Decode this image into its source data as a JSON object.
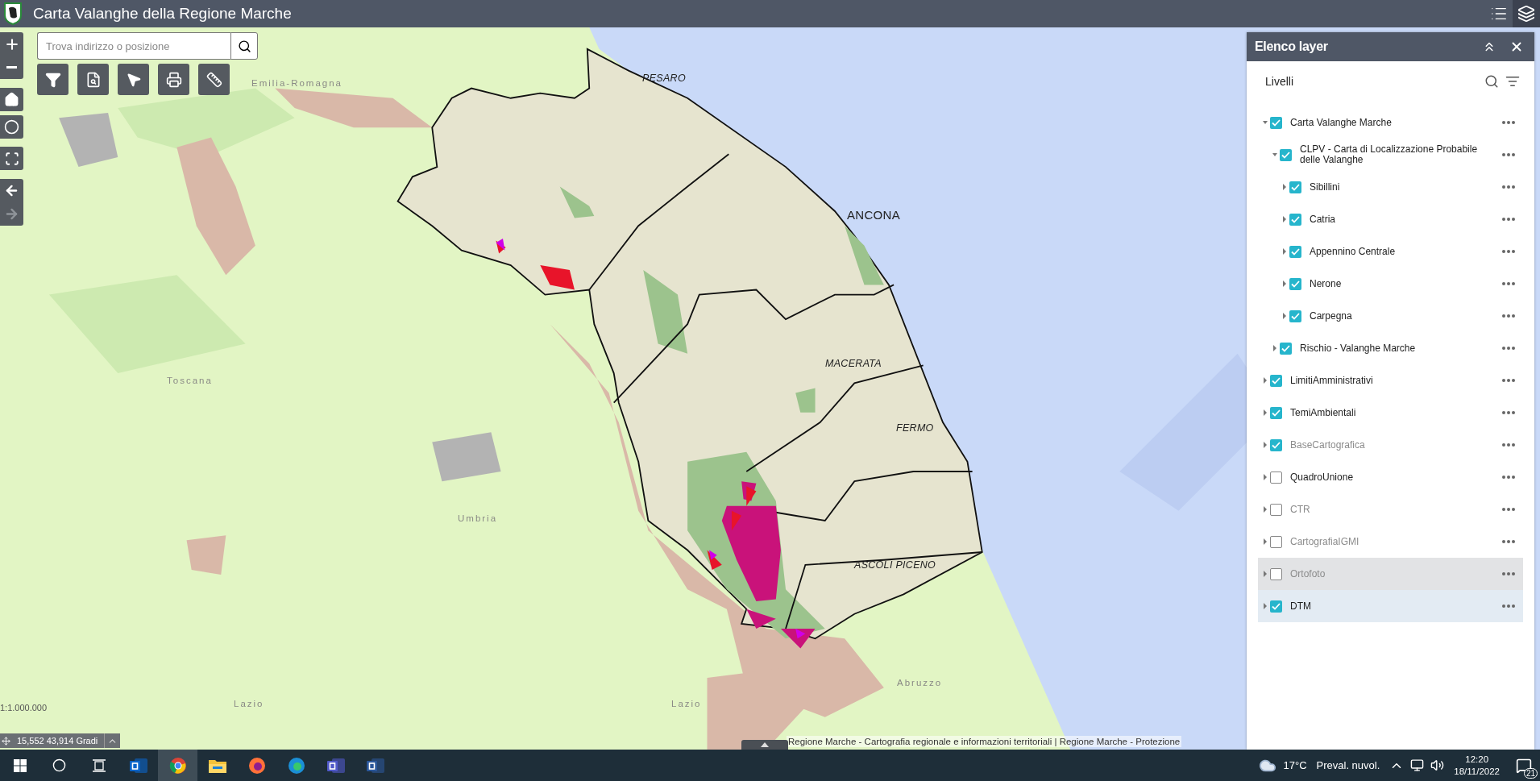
{
  "header": {
    "title": "Carta Valanghe della Regione Marche"
  },
  "search": {
    "placeholder": "Trova indirizzo o posizione"
  },
  "map": {
    "labels": [
      {
        "text": "Emilia-Romagna",
        "kind": "region"
      },
      {
        "text": "PESARO",
        "kind": "province"
      },
      {
        "text": "ANCONA",
        "kind": "capital"
      },
      {
        "text": "MACERATA",
        "kind": "province"
      },
      {
        "text": "FERMO",
        "kind": "province"
      },
      {
        "text": "ASCOLI PICENO",
        "kind": "province"
      },
      {
        "text": "Toscana",
        "kind": "region"
      },
      {
        "text": "Umbria",
        "kind": "region"
      },
      {
        "text": "Lazio",
        "kind": "region"
      },
      {
        "text": "Lazio",
        "kind": "region"
      },
      {
        "text": "Abruzzo",
        "kind": "region"
      }
    ],
    "scale": "1:1.000.000",
    "coordinates": "15,552 43,914 Gradi",
    "attribution": "Regione Marche - Cartografia regionale e informazioni territoriali | Regione Marche - Protezione"
  },
  "layer_panel": {
    "title": "Elenco layer",
    "section": "Livelli",
    "layers": [
      {
        "name": "Carta Valanghe Marche",
        "checked": true,
        "expanded": true,
        "dimmed": false,
        "hovered": false,
        "selected": false,
        "children": [
          {
            "name": "CLPV - Carta di Localizzazione Probabile delle Valanghe",
            "checked": true,
            "expanded": true,
            "dimmed": false,
            "hovered": false,
            "selected": false,
            "children": [
              {
                "name": "Sibillini",
                "checked": true,
                "expanded": false,
                "dimmed": false,
                "hovered": false,
                "selected": false
              },
              {
                "name": "Catria",
                "checked": true,
                "expanded": false,
                "dimmed": false,
                "hovered": false,
                "selected": false
              },
              {
                "name": "Appennino Centrale",
                "checked": true,
                "expanded": false,
                "dimmed": false,
                "hovered": false,
                "selected": false
              },
              {
                "name": "Nerone",
                "checked": true,
                "expanded": false,
                "dimmed": false,
                "hovered": false,
                "selected": false
              },
              {
                "name": "Carpegna",
                "checked": true,
                "expanded": false,
                "dimmed": false,
                "hovered": false,
                "selected": false
              }
            ]
          },
          {
            "name": "Rischio - Valanghe Marche",
            "checked": true,
            "expanded": false,
            "dimmed": false,
            "hovered": false,
            "selected": false
          }
        ]
      },
      {
        "name": "LimitiAmministrativi",
        "checked": true,
        "expanded": false,
        "dimmed": false,
        "hovered": false,
        "selected": false
      },
      {
        "name": "TemiAmbientali",
        "checked": true,
        "expanded": false,
        "dimmed": false,
        "hovered": false,
        "selected": false
      },
      {
        "name": "BaseCartografica",
        "checked": true,
        "expanded": false,
        "dimmed": true,
        "hovered": false,
        "selected": false
      },
      {
        "name": "QuadroUnione",
        "checked": false,
        "expanded": false,
        "dimmed": false,
        "hovered": false,
        "selected": false
      },
      {
        "name": "CTR",
        "checked": false,
        "expanded": false,
        "dimmed": true,
        "hovered": false,
        "selected": false
      },
      {
        "name": "CartografiaIGMI",
        "checked": false,
        "expanded": false,
        "dimmed": true,
        "hovered": false,
        "selected": false
      },
      {
        "name": "Ortofoto",
        "checked": false,
        "expanded": false,
        "dimmed": true,
        "hovered": true,
        "selected": false
      },
      {
        "name": "DTM",
        "checked": true,
        "expanded": false,
        "dimmed": false,
        "hovered": false,
        "selected": true
      }
    ]
  },
  "taskbar": {
    "apps": [
      {
        "selected": false
      },
      {
        "selected": true
      },
      {
        "selected": false
      },
      {
        "selected": false
      },
      {
        "selected": false
      },
      {
        "selected": false
      },
      {
        "selected": false
      }
    ],
    "weather": {
      "temperature": "17°C",
      "condition": "Preval. nuvol."
    },
    "time": "12:20",
    "date": "18/11/2022",
    "notifications": "21"
  }
}
